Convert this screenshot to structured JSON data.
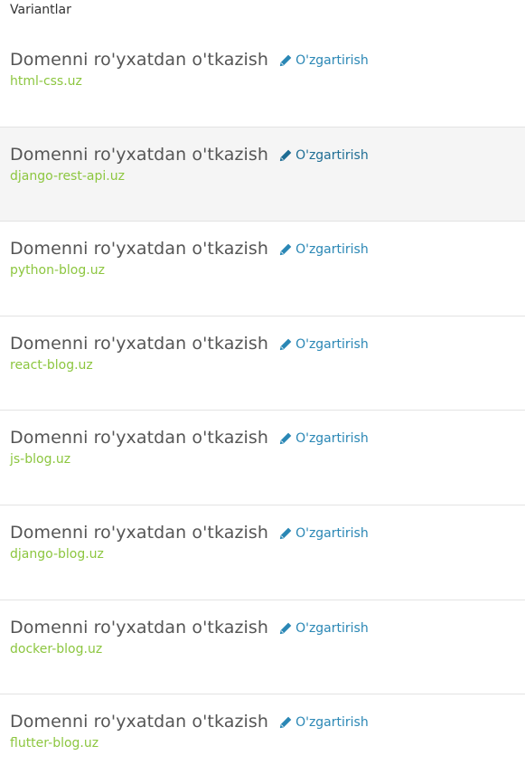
{
  "section_title": "Variantlar",
  "items": [
    {
      "title": "Domenni ro'yxatdan o'tkazish",
      "edit_label": "O'zgartirish",
      "domain": "html-css.uz"
    },
    {
      "title": "Domenni ro'yxatdan o'tkazish",
      "edit_label": "O'zgartirish",
      "domain": "django-rest-api.uz"
    },
    {
      "title": "Domenni ro'yxatdan o'tkazish",
      "edit_label": "O'zgartirish",
      "domain": "python-blog.uz"
    },
    {
      "title": "Domenni ro'yxatdan o'tkazish",
      "edit_label": "O'zgartirish",
      "domain": "react-blog.uz"
    },
    {
      "title": "Domenni ro'yxatdan o'tkazish",
      "edit_label": "O'zgartirish",
      "domain": "js-blog.uz"
    },
    {
      "title": "Domenni ro'yxatdan o'tkazish",
      "edit_label": "O'zgartirish",
      "domain": "django-blog.uz"
    },
    {
      "title": "Domenni ro'yxatdan o'tkazish",
      "edit_label": "O'zgartirish",
      "domain": "docker-blog.uz"
    },
    {
      "title": "Domenni ro'yxatdan o'tkazish",
      "edit_label": "O'zgartirish",
      "domain": "flutter-blog.uz"
    }
  ],
  "selected_index": 1,
  "icons": {
    "edit": "pencil-icon"
  },
  "colors": {
    "title": "#555555",
    "link": "#2a87b5",
    "domain": "#8cc63f",
    "selected_background": "#f5f5f5",
    "divider": "#e3e3e3"
  }
}
